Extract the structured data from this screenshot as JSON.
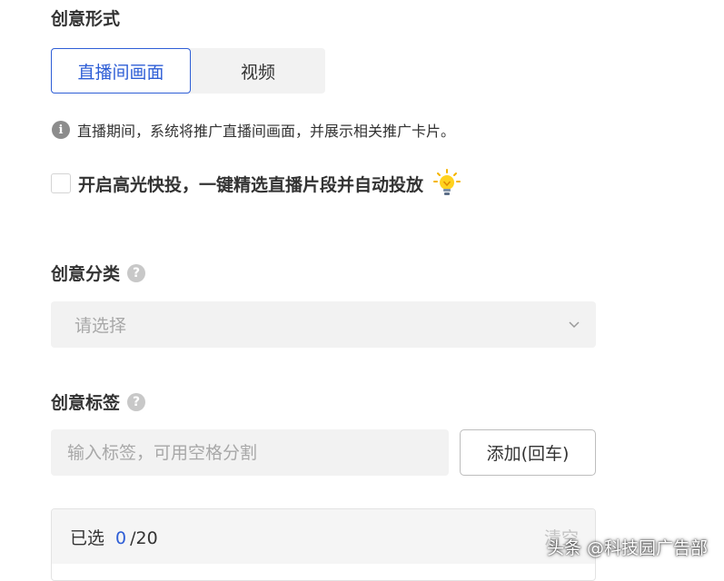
{
  "creative_form": {
    "title": "创意形式",
    "options": [
      "直播间画面",
      "视频"
    ],
    "selected": "直播间画面",
    "info_icon": "info-circle-icon",
    "info_text": "直播期间，系统将推广直播间画面，并展示相关推广卡片。"
  },
  "highlight": {
    "checked": false,
    "label": "开启高光快投，一键精选直播片段并自动投放",
    "icon": "lightbulb-icon"
  },
  "category": {
    "title": "创意分类",
    "help_icon": "?",
    "placeholder": "请选择"
  },
  "tags": {
    "title": "创意标签",
    "help_icon": "?",
    "placeholder": "输入标签，可用空格分割",
    "add_button": "添加(回车)",
    "selected_label": "已选",
    "selected_count": "0",
    "max_count": "/20",
    "clear_label": "清空"
  },
  "watermark": "头条 @科技园广告部",
  "colors": {
    "accent": "#2e5ed6",
    "field_bg": "#f2f2f2",
    "text": "#333333",
    "placeholder": "#a8a8a8"
  }
}
